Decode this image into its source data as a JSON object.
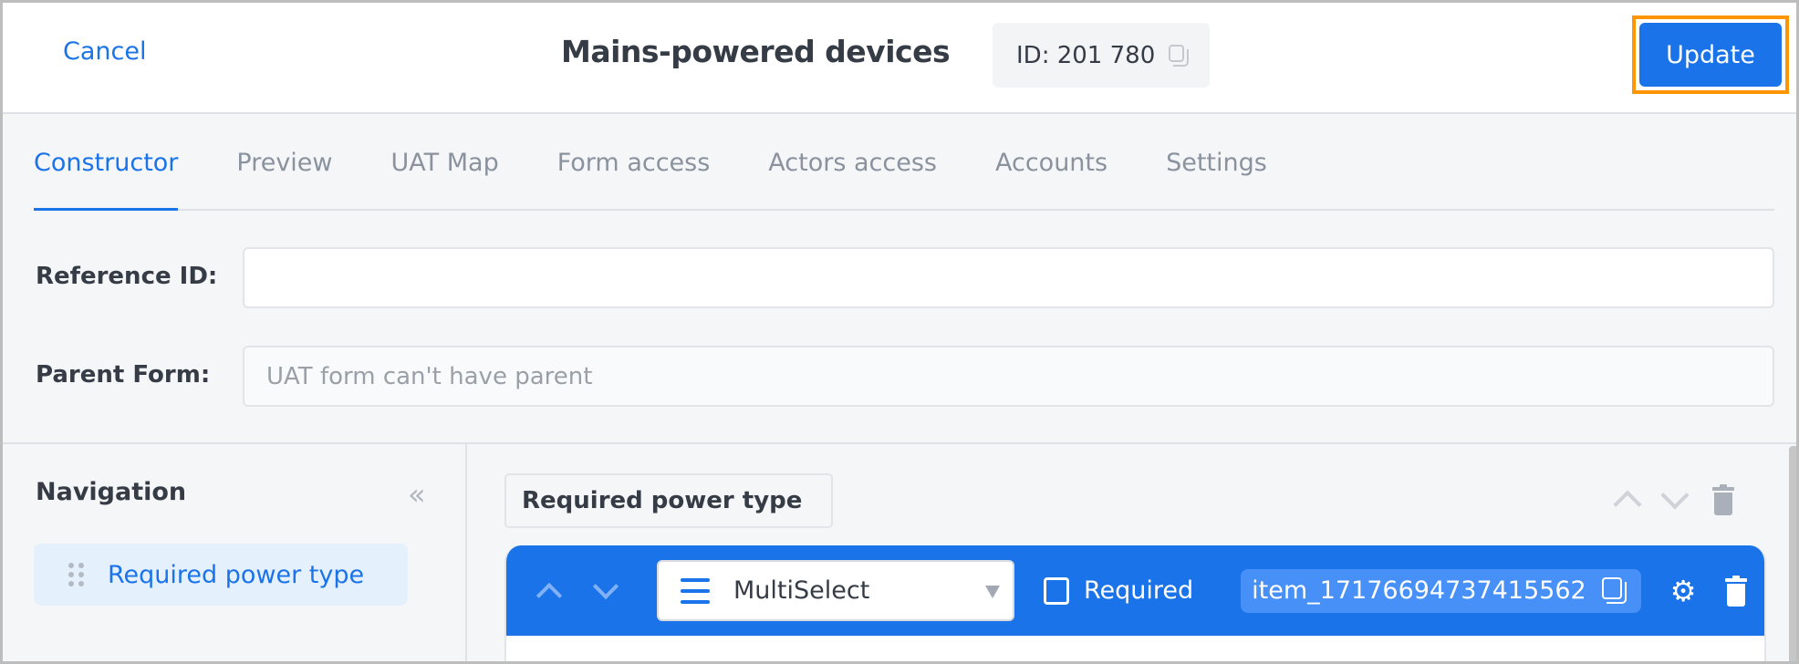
{
  "header": {
    "cancel_label": "Cancel",
    "title": "Mains-powered devices",
    "id_label": "ID: 201 780",
    "update_label": "Update"
  },
  "tabs": [
    {
      "label": "Constructor",
      "active": true
    },
    {
      "label": "Preview",
      "active": false
    },
    {
      "label": "UAT Map",
      "active": false
    },
    {
      "label": "Form access",
      "active": false
    },
    {
      "label": "Actors access",
      "active": false
    },
    {
      "label": "Accounts",
      "active": false
    },
    {
      "label": "Settings",
      "active": false
    }
  ],
  "form": {
    "reference_id_label": "Reference ID:",
    "reference_id_value": "",
    "parent_form_label": "Parent Form:",
    "parent_form_placeholder": "UAT form can't have parent"
  },
  "navigation": {
    "title": "Navigation",
    "collapse_icon": "double-chevron-left-icon",
    "items": [
      {
        "label": "Required power type"
      }
    ]
  },
  "field": {
    "title": "Required power type",
    "type": "MultiSelect",
    "required_label": "Required",
    "required_checked": false,
    "item_id": "item_17176694737415562"
  },
  "colors": {
    "accent": "#1a73e8",
    "highlight_border": "#ff9500",
    "nav_active_bg": "#e5f0fd",
    "item_id_bg": "#4790f7"
  }
}
